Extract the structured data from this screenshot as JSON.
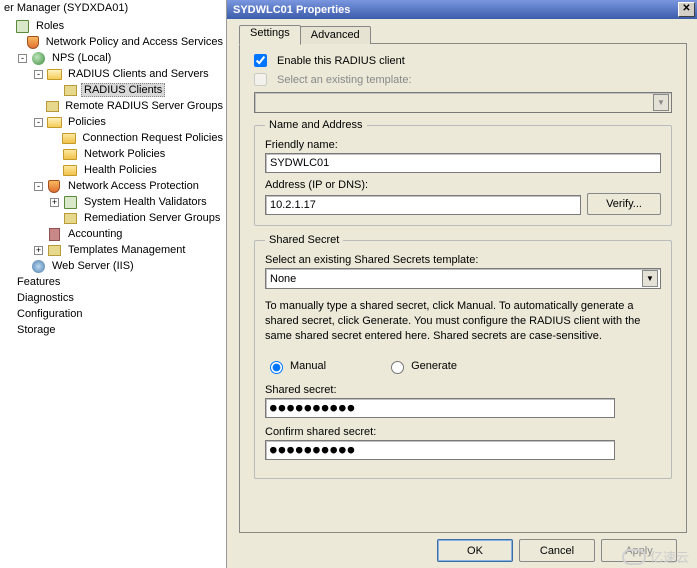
{
  "left": {
    "window_title": "er Manager (SYDXDA01)",
    "roles": "Roles",
    "npas": "Network Policy and Access Services",
    "nps_local": "NPS (Local)",
    "radius_cs": "RADIUS Clients and Servers",
    "radius_clients": "RADIUS Clients",
    "remote_radius": "Remote RADIUS Server Groups",
    "policies": "Policies",
    "crp": "Connection Request Policies",
    "np": "Network Policies",
    "hp": "Health Policies",
    "nap": "Network Access Protection",
    "shv": "System Health Validators",
    "rsg": "Remediation Server Groups",
    "accounting": "Accounting",
    "templates": "Templates Management",
    "web_iis": "Web Server (IIS)",
    "features": "Features",
    "diagnostics": "Diagnostics",
    "configuration": "Configuration",
    "storage": "Storage"
  },
  "dialog": {
    "title": "SYDWLC01 Properties",
    "tabs": {
      "settings": "Settings",
      "advanced": "Advanced"
    },
    "enable_label": "Enable this RADIUS client",
    "select_template_label": "Select an existing template:",
    "name_address": {
      "legend": "Name and Address",
      "friendly_label": "Friendly name:",
      "friendly_value": "SYDWLC01",
      "address_label": "Address (IP or DNS):",
      "address_value": "10.2.1.17",
      "verify": "Verify..."
    },
    "shared_secret": {
      "legend": "Shared Secret",
      "select_label": "Select an existing Shared Secrets template:",
      "select_value": "None",
      "helptext": "To manually type a shared secret, click Manual. To automatically generate a shared secret, click Generate. You must configure the RADIUS client with the same shared secret entered here. Shared secrets are case-sensitive.",
      "manual": "Manual",
      "generate": "Generate",
      "secret_label": "Shared secret:",
      "secret_value": "●●●●●●●●●●",
      "confirm_label": "Confirm shared secret:",
      "confirm_value": "●●●●●●●●●●"
    },
    "buttons": {
      "ok": "OK",
      "cancel": "Cancel",
      "apply": "Apply"
    }
  },
  "watermark": "亿速云"
}
